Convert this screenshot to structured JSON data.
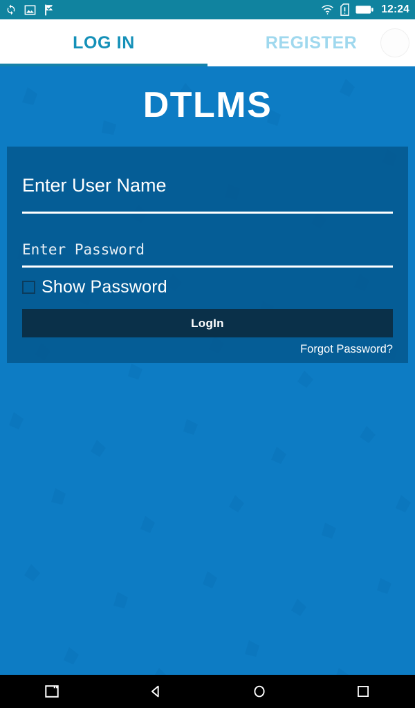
{
  "status_bar": {
    "background": "#10839f",
    "time": "12:24",
    "left_icons": [
      {
        "name": "sync-icon"
      },
      {
        "name": "image-icon"
      },
      {
        "name": "flag-check-icon"
      }
    ],
    "right_icons": [
      {
        "name": "wifi-icon"
      },
      {
        "name": "sim-alert-icon"
      },
      {
        "name": "battery-icon"
      }
    ]
  },
  "tabs": {
    "active_index": 0,
    "active_color": "#1490b8",
    "inactive_color": "#9fd8ee",
    "indicator_color": "#1682aa",
    "items": [
      {
        "label": "LOG IN"
      },
      {
        "label": "REGISTER"
      }
    ]
  },
  "app": {
    "title": "DTLMS",
    "background": "#0d7cc4",
    "card_background": "#04558b"
  },
  "form": {
    "username": {
      "value": "",
      "placeholder": "Enter User Name"
    },
    "password": {
      "value": "",
      "placeholder": "Enter Password"
    },
    "show_password": {
      "label": "Show Password",
      "checked": false
    },
    "submit_label": "LogIn",
    "submit_color": "#0a3049",
    "forgot_label": "Forgot Password?"
  },
  "nav_bar": {
    "background": "#000000",
    "items": [
      {
        "name": "screenshot-icon"
      },
      {
        "name": "back-icon"
      },
      {
        "name": "home-icon"
      },
      {
        "name": "recents-icon"
      }
    ]
  }
}
